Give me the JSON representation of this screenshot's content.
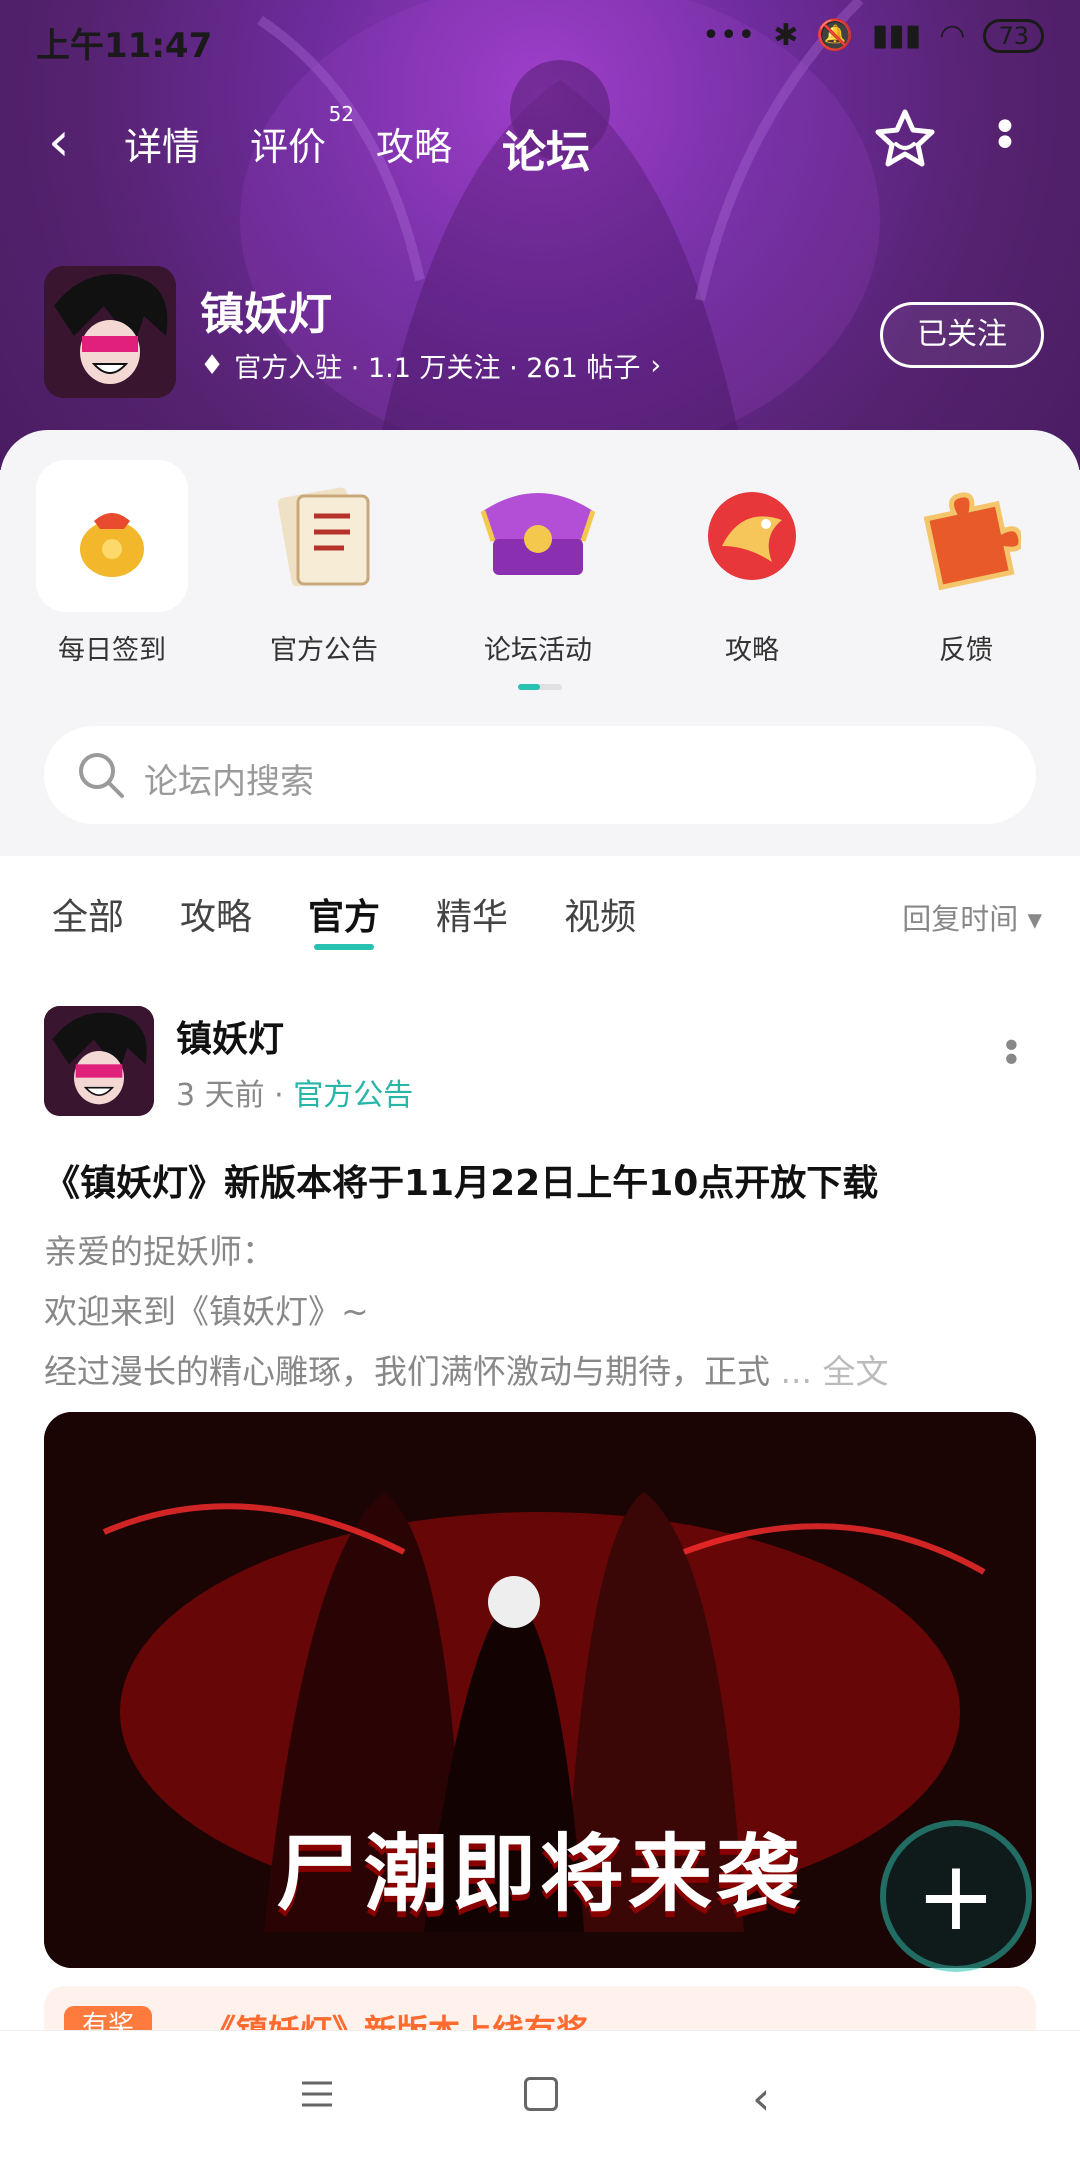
{
  "status": {
    "time": "上午11:47",
    "battery": "73"
  },
  "topnav": {
    "tabs": [
      {
        "label": "详情"
      },
      {
        "label": "评价",
        "badge": "52"
      },
      {
        "label": "攻略"
      },
      {
        "label": "论坛"
      }
    ]
  },
  "game": {
    "name": "镇妖灯",
    "meta": "官方入驻 · 1.1 万关注 · 261 帖子",
    "follow_label": "已关注"
  },
  "quick_links": [
    {
      "label": "每日签到",
      "icon": "lucky-bag-icon"
    },
    {
      "label": "官方公告",
      "icon": "scroll-notice-icon"
    },
    {
      "label": "论坛活动",
      "icon": "treasure-chest-icon"
    },
    {
      "label": "攻略",
      "icon": "dragon-emblem-icon"
    },
    {
      "label": "反馈",
      "icon": "puzzle-piece-icon"
    }
  ],
  "search": {
    "placeholder": "论坛内搜索"
  },
  "filters": {
    "items": [
      "全部",
      "攻略",
      "官方",
      "精华",
      "视频"
    ],
    "sort_label": "回复时间"
  },
  "post": {
    "author": "镇妖灯",
    "time": "3 天前",
    "tag": "官方公告",
    "title": "《镇妖灯》新版本将于11月22日上午10点开放下载",
    "line1": "亲爱的捉妖师：",
    "line2": " 欢迎来到《镇妖灯》~",
    "line3": " 经过漫长的精心雕琢，我们满怀激动与期待，正式",
    "more_label": "... 全文",
    "image_caption": "尸潮即将来袭"
  },
  "next_post": {
    "badge": "有奖",
    "title": "《镇妖灯》新版本上线有奖"
  },
  "colors": {
    "accent": "#27c2b2",
    "hero": "#6d2c9c"
  }
}
